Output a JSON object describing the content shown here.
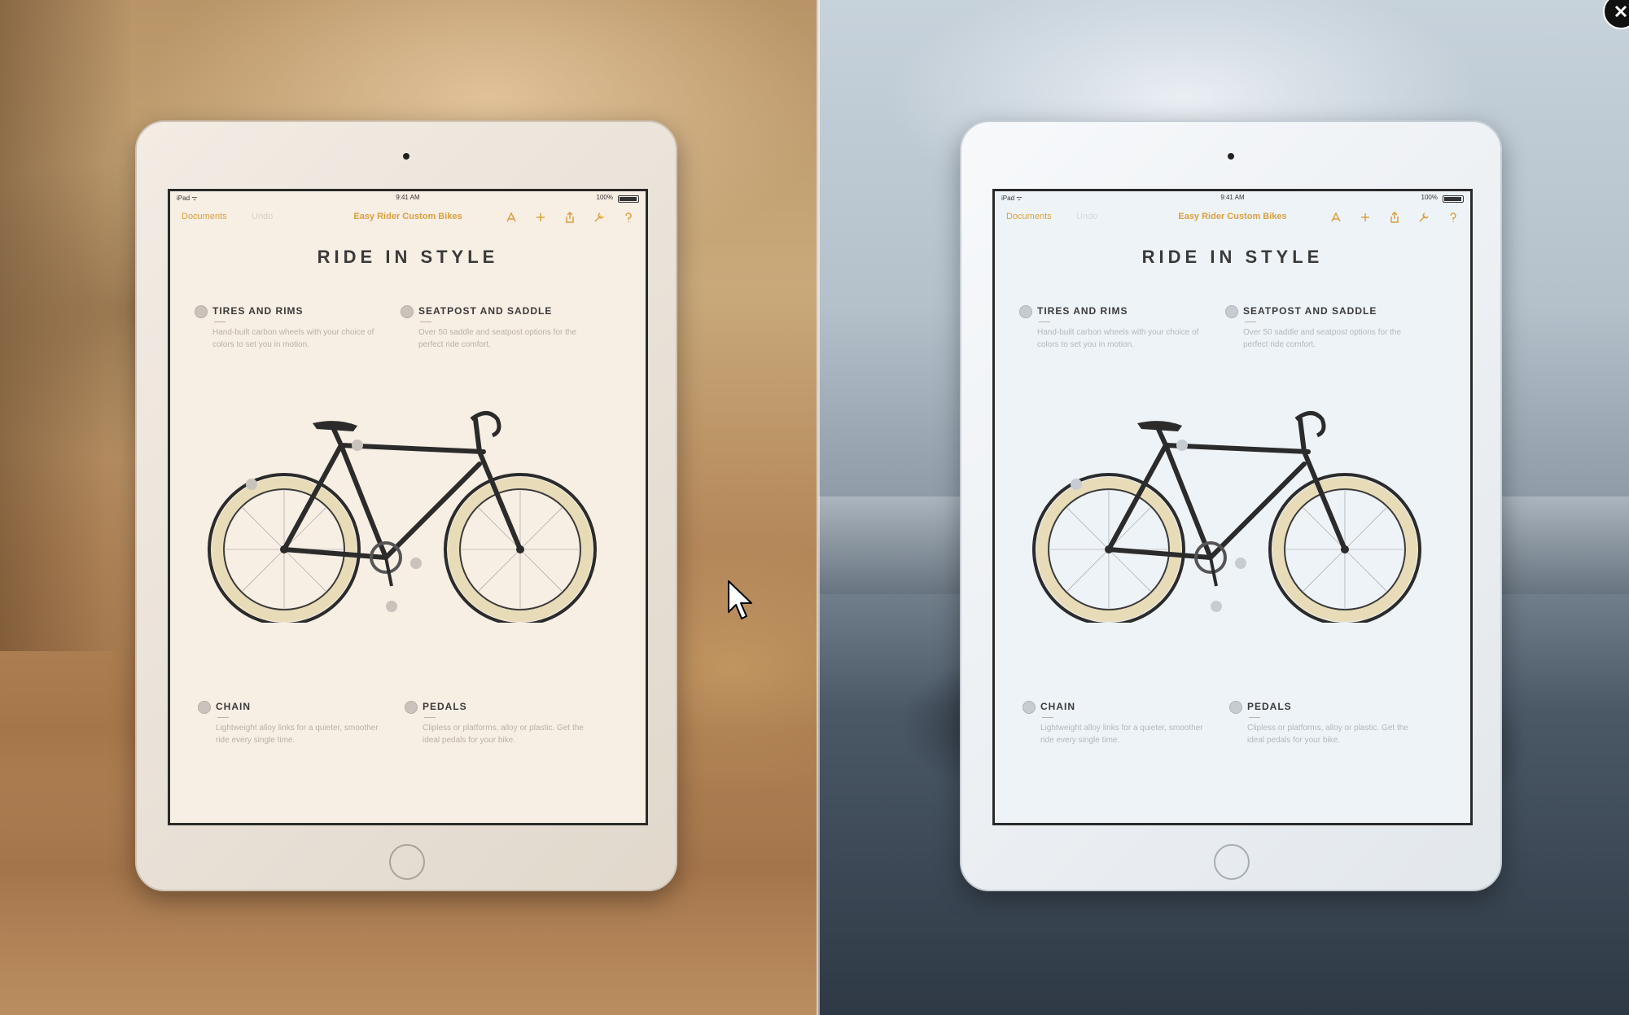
{
  "devices": {
    "left": {
      "status": {
        "carrier": "iPad ᯤ",
        "time": "9:41 AM",
        "battery": "100%"
      },
      "nav": {
        "back": "Documents",
        "undo": "Undo",
        "title": "Easy Rider Custom Bikes"
      },
      "doc_title": "RIDE IN STYLE",
      "features": [
        {
          "name": "TIRES AND RIMS",
          "desc": "Hand-built carbon wheels with your choice of colors to set you in motion."
        },
        {
          "name": "SEATPOST AND SADDLE",
          "desc": "Over 50 saddle and seatpost options for the perfect ride comfort."
        },
        {
          "name": "CHAIN",
          "desc": "Lightweight alloy links for a quieter, smoother ride every single time."
        },
        {
          "name": "PEDALS",
          "desc": "Clipless or platforms, alloy or plastic. Get the ideal pedals for your bike."
        }
      ]
    },
    "right": {
      "status": {
        "carrier": "iPad ᯤ",
        "time": "9:41 AM",
        "battery": "100%"
      },
      "nav": {
        "back": "Documents",
        "undo": "Undo",
        "title": "Easy Rider Custom Bikes"
      },
      "doc_title": "RIDE IN STYLE",
      "features": [
        {
          "name": "TIRES AND RIMS",
          "desc": "Hand-built carbon wheels with your choice of colors to set you in motion."
        },
        {
          "name": "SEATPOST AND SADDLE",
          "desc": "Over 50 saddle and seatpost options for the perfect ride comfort."
        },
        {
          "name": "CHAIN",
          "desc": "Lightweight alloy links for a quieter, smoother ride every single time."
        },
        {
          "name": "PEDALS",
          "desc": "Clipless or platforms, alloy or plastic. Get the ideal pedals for your bike."
        }
      ]
    }
  },
  "colors": {
    "accent": "#d9a040",
    "rim": "#e8dcb8",
    "frame": "#2b2b2b"
  },
  "icons": [
    "brush-icon",
    "plus-icon",
    "share-icon",
    "wrench-icon",
    "help-icon",
    "close-icon",
    "cursor-icon"
  ]
}
